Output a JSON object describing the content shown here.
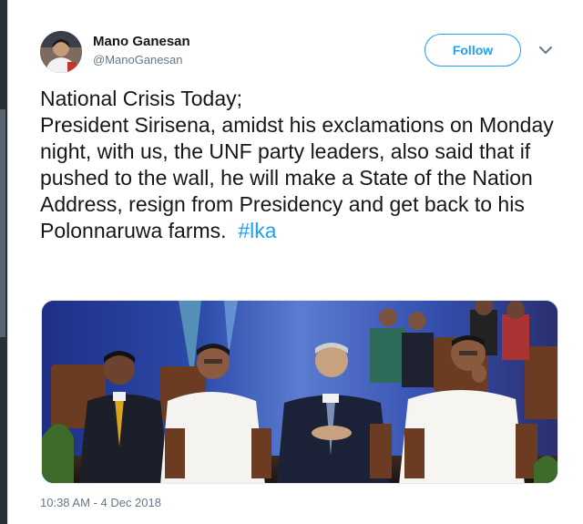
{
  "tweet": {
    "display_name": "Mano Ganesan",
    "handle": "@ManoGanesan",
    "follow_label": "Follow",
    "text": "National Crisis Today;\nPresident Sirisena, amidst his exclamations on Monday night, with us, the UNF party leaders, also said that if pushed to the wall, he will make a State of the Nation Address, resign from Presidency and get back to his Polonnaruwa farms.  ",
    "hashtag": "#lka",
    "timestamp": "10:38 AM - 4 Dec 2018"
  },
  "icons": {
    "menu": "chevron-down-icon"
  },
  "colors": {
    "accent": "#1da1f2",
    "text": "#14171a",
    "muted": "#657786"
  }
}
